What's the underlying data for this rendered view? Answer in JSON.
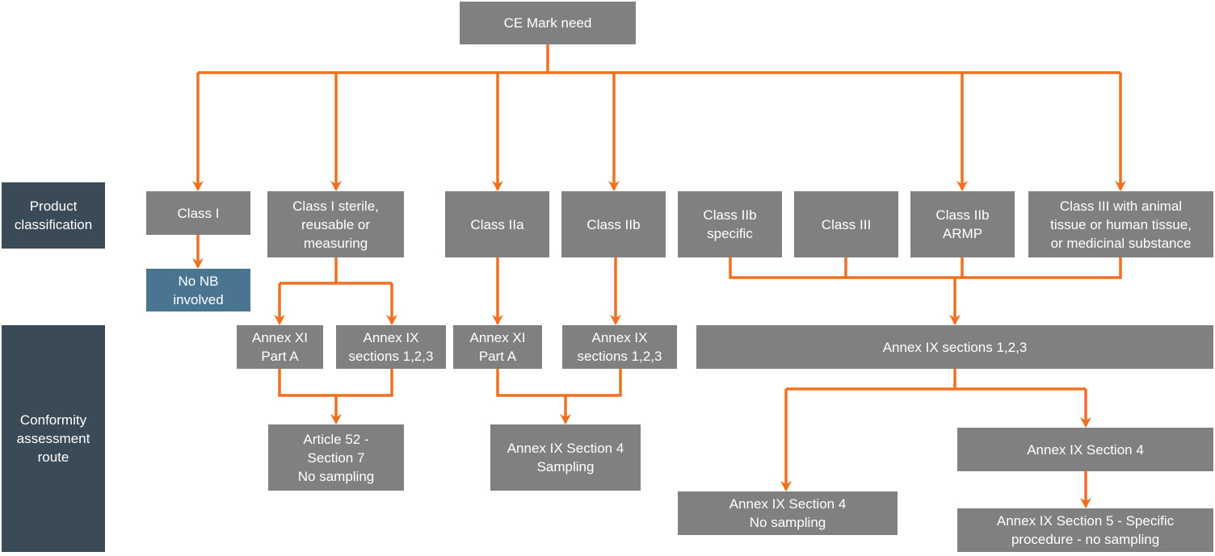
{
  "colors": {
    "box_fill": "#808080",
    "row_label_fill": "#3a4b57",
    "no_nb_fill": "#4a7590",
    "connector": "#f07020",
    "text": "#ffffff"
  },
  "root": {
    "label": "CE Mark need"
  },
  "row_labels": {
    "product_classification": "Product\nclassification",
    "conformity_assessment_route": "Conformity\nassessment\nroute"
  },
  "classes": [
    {
      "id": "class-i",
      "label": "Class I"
    },
    {
      "id": "class-i-sterile",
      "label": "Class I sterile,\nreusable or\nmeasuring"
    },
    {
      "id": "class-iia",
      "label": "Class IIa"
    },
    {
      "id": "class-iib",
      "label": "Class IIb"
    },
    {
      "id": "class-iib-specific",
      "label": "Class IIb\nspecific"
    },
    {
      "id": "class-iii",
      "label": "Class III"
    },
    {
      "id": "class-iib-armp",
      "label": "Class IIb\nARMP"
    },
    {
      "id": "class-iii-animal",
      "label": "Class III with animal\ntissue or human tissue,\nor medicinal substance"
    }
  ],
  "routes": {
    "no_nb": "No NB\ninvolved",
    "annex_xi_a_1": "Annex XI\nPart A",
    "annex_ix_123_1": "Annex IX\nsections 1,2,3",
    "annex_xi_a_2": "Annex XI\nPart A",
    "annex_ix_123_2": "Annex IX\nsections 1,2,3",
    "annex_ix_123_wide": "Annex IX sections 1,2,3",
    "article_52": "Article 52 -\nSection 7\nNo sampling",
    "annex_ix_s4_sampling": "Annex IX Section 4\nSampling",
    "annex_ix_s4": "Annex IX Section 4",
    "annex_ix_s4_no_sampling": "Annex IX Section 4\nNo sampling",
    "annex_ix_s5": "Annex IX Section 5 - Specific\nprocedure - no sampling"
  }
}
